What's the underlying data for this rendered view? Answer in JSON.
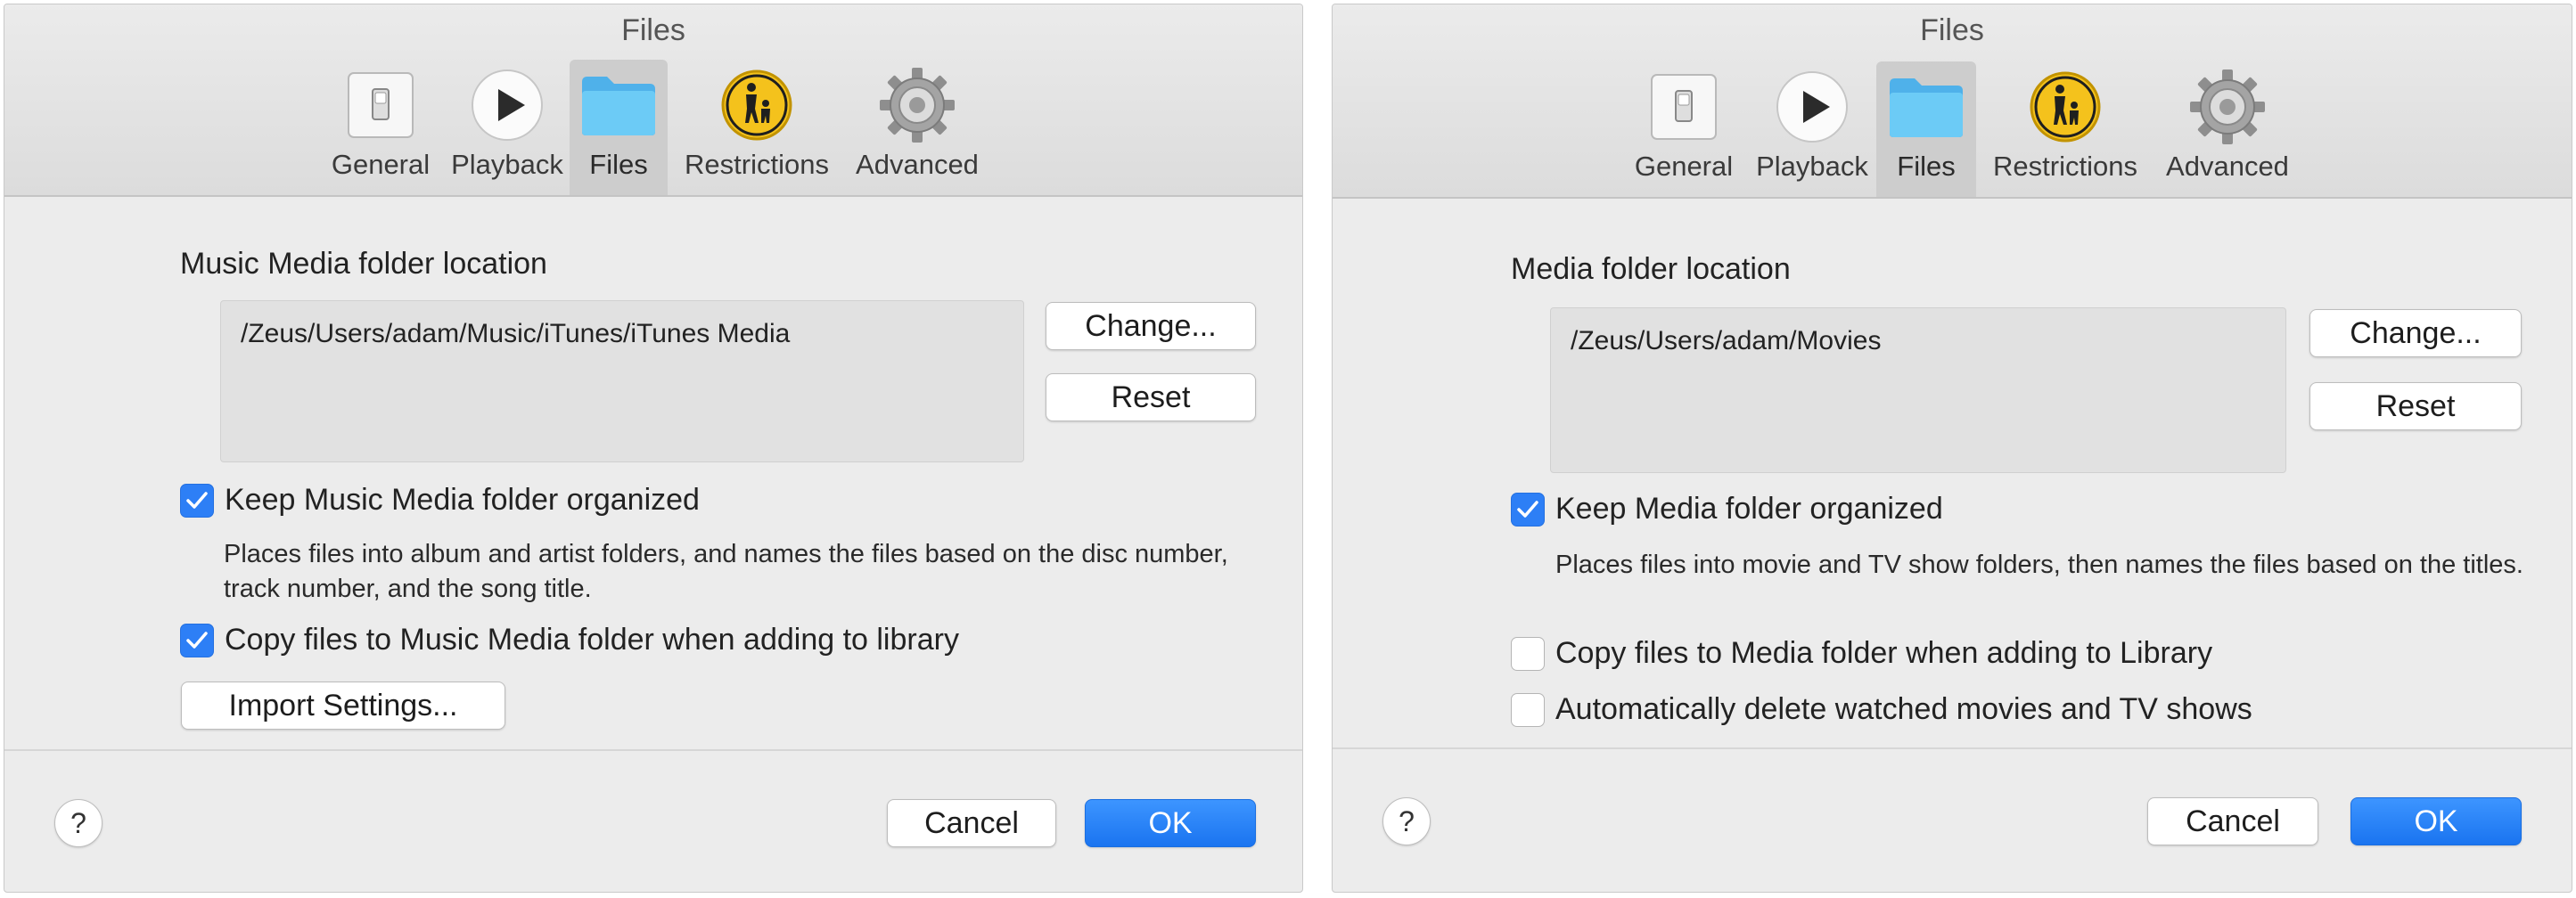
{
  "left": {
    "title": "Files",
    "tabs": [
      {
        "label": "General",
        "icon": "switch-icon"
      },
      {
        "label": "Playback",
        "icon": "play-icon"
      },
      {
        "label": "Files",
        "icon": "folder-icon"
      },
      {
        "label": "Restrictions",
        "icon": "parental-icon"
      },
      {
        "label": "Advanced",
        "icon": "gear-icon"
      }
    ],
    "selected_tab": "Files",
    "folder_label": "Music Media folder location",
    "folder_path": "/Zeus/Users/adam/Music/iTunes/iTunes Media",
    "change_label": "Change...",
    "reset_label": "Reset",
    "keep_organized_label": "Keep Music Media folder organized",
    "keep_organized_checked": true,
    "keep_organized_desc": "Places files into album and artist folders, and names the files based on the disc number, track number, and the song title.",
    "copy_files_label": "Copy files to Music Media folder when adding to library",
    "copy_files_checked": true,
    "import_settings_label": "Import Settings...",
    "help_label": "?",
    "cancel_label": "Cancel",
    "ok_label": "OK"
  },
  "right": {
    "title": "Files",
    "tabs": [
      {
        "label": "General",
        "icon": "switch-icon"
      },
      {
        "label": "Playback",
        "icon": "play-icon"
      },
      {
        "label": "Files",
        "icon": "folder-icon"
      },
      {
        "label": "Restrictions",
        "icon": "parental-icon"
      },
      {
        "label": "Advanced",
        "icon": "gear-icon"
      }
    ],
    "selected_tab": "Files",
    "folder_label": "Media folder location",
    "folder_path": "/Zeus/Users/adam/Movies",
    "change_label": "Change...",
    "reset_label": "Reset",
    "keep_organized_label": "Keep Media folder organized",
    "keep_organized_checked": true,
    "keep_organized_desc": "Places files into movie and TV show folders, then names the files based on the titles.",
    "copy_files_label": "Copy files to Media folder when adding to Library",
    "copy_files_checked": false,
    "auto_delete_label": "Automatically delete watched movies and TV shows",
    "auto_delete_checked": false,
    "help_label": "?",
    "cancel_label": "Cancel",
    "ok_label": "OK"
  },
  "colors": {
    "accent": "#2d7ff6",
    "window_bg": "#ececec",
    "selected_tab_bg": "#cdcdcd",
    "restrictions_yellow": "#f4c21c"
  }
}
